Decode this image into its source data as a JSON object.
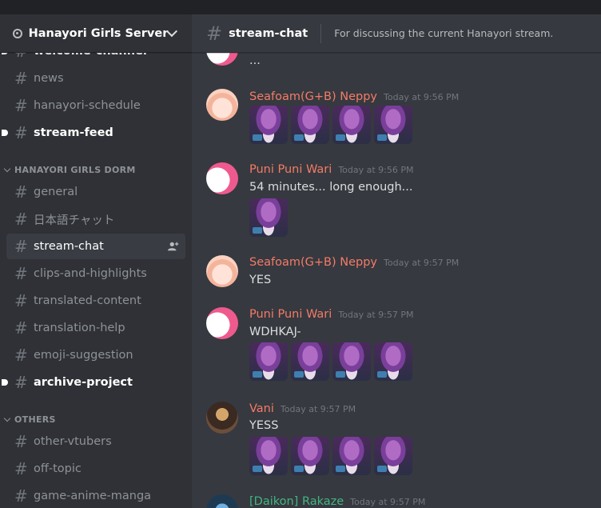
{
  "server": {
    "name": "Hanayori Girls Server"
  },
  "sidebar": {
    "channels_top": [
      {
        "label": "welcome-channel",
        "unread": true
      },
      {
        "label": "news",
        "unread": false
      },
      {
        "label": "hanayori-schedule",
        "unread": false
      },
      {
        "label": "stream-feed",
        "unread": true
      }
    ],
    "category_dorm": "HANAYORI GIRLS DORM",
    "channels_dorm": [
      {
        "label": "general"
      },
      {
        "label": "日本語チャット"
      },
      {
        "label": "stream-chat",
        "active": true
      },
      {
        "label": "clips-and-highlights"
      },
      {
        "label": "translated-content"
      },
      {
        "label": "translation-help"
      },
      {
        "label": "emoji-suggestion"
      },
      {
        "label": "archive-project",
        "unread": true
      }
    ],
    "category_others": "OTHERS",
    "channels_others": [
      {
        "label": "other-vtubers"
      },
      {
        "label": "off-topic"
      },
      {
        "label": "game-anime-manga"
      }
    ]
  },
  "header": {
    "channel": "stream-chat",
    "topic": "For discussing the current Hanayori stream."
  },
  "messages": [
    {
      "text": "..."
    },
    {
      "author": "Seafoam(G+B) Neppy",
      "time": "Today at 9:56 PM",
      "emojis": 4
    },
    {
      "author": "Puni Puni Wari",
      "time": "Today at 9:56 PM",
      "text": "54 minutes... long enough...",
      "emojis": 1
    },
    {
      "author": "Seafoam(G+B) Neppy",
      "time": "Today at 9:57 PM",
      "text": "YES"
    },
    {
      "author": "Puni Puni Wari",
      "time": "Today at 9:57 PM",
      "text": "WDHKAJ-",
      "emojis": 4
    },
    {
      "author": "Vani",
      "time": "Today at 9:57 PM",
      "text": "YESS",
      "emojis": 4
    },
    {
      "author": "[Daikon] Rakaze",
      "time": "Today at 9:57 PM"
    }
  ],
  "colors": {
    "seafoam": "#f47b67",
    "puni": "#f47b67",
    "vani": "#f47b67",
    "rakaze": "#43b581"
  },
  "icons": {
    "hash": "hash-icon",
    "invite": "add-member-icon",
    "emoji": "purple-haired-character-emote"
  }
}
